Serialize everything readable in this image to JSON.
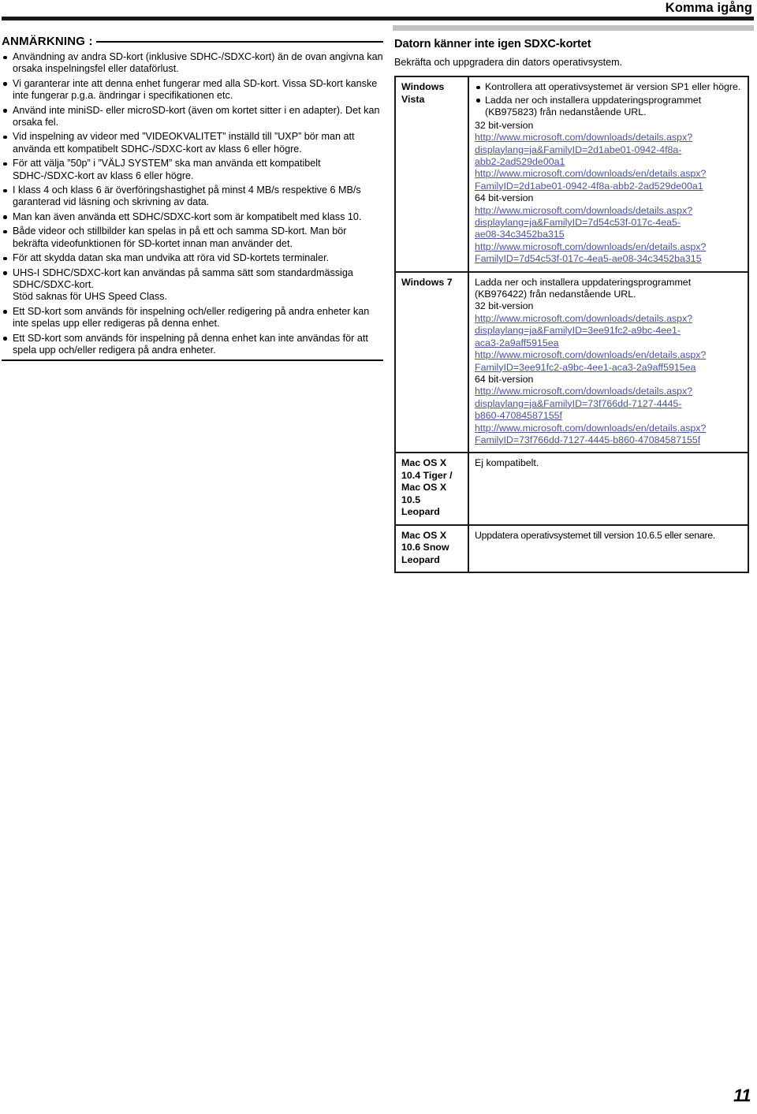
{
  "header": {
    "title": "Komma igång"
  },
  "footer": {
    "page_number": "11"
  },
  "note": {
    "label": "ANMÄRKNING :",
    "items": [
      "Användning av andra SD-kort (inklusive SDHC-/SDXC-kort) än de ovan angivna kan orsaka inspelningsfel eller dataförlust.",
      "Vi garanterar inte att denna enhet fungerar med alla SD-kort. Vissa SD-kort kanske inte fungerar p.g.a. ändringar i specifikationen etc.",
      "Använd inte miniSD- eller microSD-kort (även om kortet sitter i en adapter). Det kan orsaka fel.",
      "Vid inspelning av videor med ”VIDEOKVALITET” inställd till ”UXP” bör man att använda ett kompatibelt SDHC-/SDXC-kort av klass 6 eller högre.",
      "För att välja ”50p” i ”VÄLJ SYSTEM” ska man använda ett kompatibelt SDHC-/SDXC-kort av klass 6 eller högre.",
      "I klass 4 och klass 6 är överföringshastighet på minst 4 MB/s respektive 6 MB/s garanterad vid läsning och skrivning av data.",
      "Man kan även använda ett SDHC/SDXC-kort som är kompatibelt med klass 10.",
      "Både videor och stillbilder kan spelas in på ett och samma SD-kort. Man bör bekräfta videofunktionen för SD-kortet innan man använder det.",
      "För att skydda datan ska man undvika att röra vid SD-kortets terminaler.",
      "UHS-I SDHC/SDXC-kort kan användas på samma sätt som standardmässiga SDHC/SDXC-kort.\nStöd saknas för UHS Speed Class.",
      "Ett SD-kort som används för inspelning och/eller redigering på andra enheter kan inte spelas upp eller redigeras på denna enhet.",
      "Ett SD-kort som används för inspelning på denna enhet kan inte användas för att spela upp och/eller redigera på andra enheter."
    ]
  },
  "sdxc_section": {
    "title": "Datorn känner inte igen SDXC-kortet",
    "lede": "Bekräfta och uppgradera din dators operativsystem.",
    "rows": [
      {
        "os": "Windows\nVista",
        "bullets": [
          "Kontrollera att operativsystemet är version SP1 eller högre.",
          "Ladda ner och installera uppdateringsprogrammet (KB975823) från nedanstående URL."
        ],
        "lines": [
          {
            "kind": "plain",
            "text": "32 bit-version"
          },
          {
            "kind": "url",
            "text": "http://www.microsoft.com/downloads/details.aspx?"
          },
          {
            "kind": "url",
            "text": "displaylang=ja&FamilyID=2d1abe01-0942-4f8a-"
          },
          {
            "kind": "url",
            "text": "abb2-2ad529de00a1"
          },
          {
            "kind": "url",
            "text": "http://www.microsoft.com/downloads/en/details.aspx?"
          },
          {
            "kind": "url",
            "text": "FamilyID=2d1abe01-0942-4f8a-abb2-2ad529de00a1"
          },
          {
            "kind": "plain",
            "text": "64 bit-version"
          },
          {
            "kind": "url",
            "text": "http://www.microsoft.com/downloads/details.aspx?"
          },
          {
            "kind": "url",
            "text": "displaylang=ja&FamilyID=7d54c53f-017c-4ea5-"
          },
          {
            "kind": "url",
            "text": "ae08-34c3452ba315"
          },
          {
            "kind": "url",
            "text": "http://www.microsoft.com/downloads/en/details.aspx?"
          },
          {
            "kind": "url",
            "text": "FamilyID=7d54c53f-017c-4ea5-ae08-34c3452ba315"
          }
        ]
      },
      {
        "os": "Windows 7",
        "bullets": [],
        "lines": [
          {
            "kind": "plain",
            "text": "Ladda ner och installera uppdateringsprogrammet"
          },
          {
            "kind": "plain",
            "text": "(KB976422) från nedanstående URL."
          },
          {
            "kind": "plain",
            "text": "32 bit-version"
          },
          {
            "kind": "url",
            "text": "http://www.microsoft.com/downloads/details.aspx?"
          },
          {
            "kind": "url",
            "text": "displaylang=ja&FamilyID=3ee91fc2-a9bc-4ee1-"
          },
          {
            "kind": "url",
            "text": "aca3-2a9aff5915ea"
          },
          {
            "kind": "url",
            "text": "http://www.microsoft.com/downloads/en/details.aspx?"
          },
          {
            "kind": "url",
            "text": "FamilyID=3ee91fc2-a9bc-4ee1-aca3-2a9aff5915ea"
          },
          {
            "kind": "plain",
            "text": "64 bit-version"
          },
          {
            "kind": "url",
            "text": "http://www.microsoft.com/downloads/details.aspx?"
          },
          {
            "kind": "url",
            "text": "displaylang=ja&FamilyID=73f766dd-7127-4445-"
          },
          {
            "kind": "url",
            "text": "b860-47084587155f"
          },
          {
            "kind": "url",
            "text": "http://www.microsoft.com/downloads/en/details.aspx?"
          },
          {
            "kind": "url",
            "text": "FamilyID=73f766dd-7127-4445-b860-47084587155f"
          }
        ]
      },
      {
        "os": "Mac OS X\n10.4 Tiger /\nMac OS X\n10.5\nLeopard",
        "bullets": [],
        "lines": [
          {
            "kind": "plain",
            "text": "Ej kompatibelt."
          }
        ]
      },
      {
        "os": "Mac OS X\n10.6 Snow\nLeopard",
        "bullets": [],
        "lines": [
          {
            "kind": "squeeze",
            "text": "Uppdatera operativsystemet till version 10.6.5 eller senare."
          }
        ]
      }
    ]
  },
  "colors": {
    "link": "#4a5496",
    "rule": "#1a1a1a",
    "grey_bar": "#c2c2c2"
  }
}
